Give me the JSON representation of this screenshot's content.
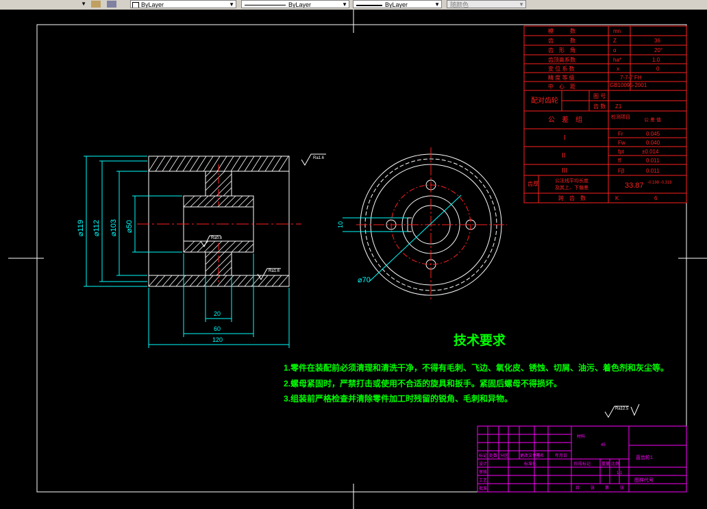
{
  "toolbar": {
    "layer_color_value": "ByLayer",
    "linetype_value": "ByLayer",
    "lineweight_value": "ByLayer",
    "plotstyle_value": "随颜色"
  },
  "dims": {
    "d119": "⌀119",
    "d112": "⌀112",
    "d103": "⌀103",
    "d50": "⌀50",
    "w20": "20",
    "w60": "60",
    "w120": "120",
    "d70": "⌀70",
    "d10": "10",
    "ra16_top": "Ra1.6",
    "ra16_side": "Ra1.6",
    "ra08": "Ra0.8",
    "ra125": "Ra12.5"
  },
  "tech": {
    "title": "技术要求",
    "items": [
      "1.零件在装配前必须清理和清洗干净，不得有毛刺、飞边、氧化皮、锈蚀、切屑、油污、着色剂和灰尘等。",
      "2.螺母紧固时，严禁打击或使用不合适的旋具和扳手。紧固后螺母不得损坏。",
      "3.组装前严格检查并清除零件加工时残留的锐角、毛刺和异物。"
    ]
  },
  "gear_table": {
    "rows": [
      {
        "label": "模　　　数",
        "sym": "mn",
        "val": ""
      },
      {
        "label": "齿　　　数",
        "sym": "Z",
        "val": "36"
      },
      {
        "label": "齿　形　角",
        "sym": "α",
        "val": "20°"
      },
      {
        "label": "齿顶高系数",
        "sym": "ha*",
        "val": "1.0"
      },
      {
        "label": "变 位 系 数",
        "sym": "x",
        "val": "0"
      },
      {
        "label": "精 度 等 级",
        "sym": "",
        "val": "7-7-7 FH"
      },
      {
        "label": "中　心　距",
        "sym": "",
        "val": "GB10095-2001"
      }
    ],
    "mate_label": "配对齿轮",
    "mate_sub1": "图 号",
    "mate_sub2": "齿 数",
    "mate_z": "Z1",
    "tol_group": "公　差　组",
    "check_item": "检测项目",
    "tol_value": "公 差 值",
    "group1": "I",
    "group2": "II",
    "group3": "III",
    "fr": "Fr",
    "fr_v": "0.045",
    "fw": "Fw",
    "fw_v": "0.040",
    "fpt": "fpt",
    "fpt_v": "±0.014",
    "ff": "ff",
    "ff_v": "0.011",
    "fb": "Fβ",
    "fb_v": "0.011",
    "tooth_thk": "齿厚",
    "common_len": "公法线平均长度",
    "deviation": "及其上、下偏差",
    "len_val": "33.87",
    "len_tol": "-0.198\n-0.316",
    "span_label": "跨　齿　数",
    "span_sym": "K",
    "span_val": "6"
  },
  "title_block": {
    "material_label": "材料",
    "material_value": "45",
    "part_name": "直齿轮1",
    "drawing_no": "图样代号",
    "scale": "1:1",
    "marks": [
      "标记",
      "处数",
      "分区",
      "更改文件号",
      "签名",
      "年月日"
    ],
    "roles": [
      "设计",
      "审核",
      "工艺",
      "批准"
    ],
    "std": "标准化",
    "stage": "阶段标记",
    "weight": "重量",
    "ratio": "比例",
    "sheet": [
      "共",
      "张",
      "第",
      "张"
    ]
  },
  "colors": {
    "cyan": "#00ffff",
    "red": "#ff2020",
    "green": "#00ff00",
    "magenta": "#ff00ff",
    "white": "#ffffff",
    "yellow": "#ffff00"
  }
}
